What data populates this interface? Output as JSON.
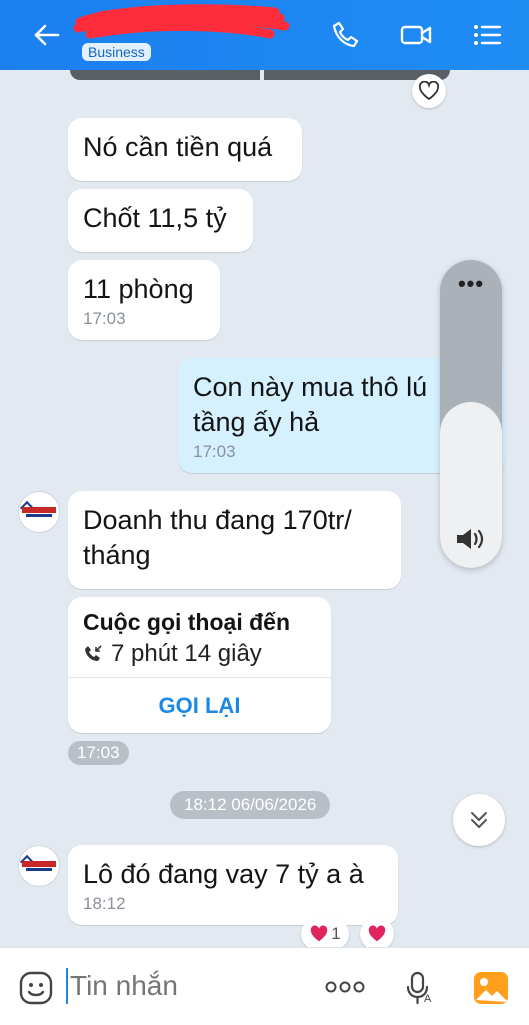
{
  "header": {
    "back_icon": "arrow-left-icon",
    "badge": "Business",
    "actions": [
      "phone-icon",
      "video-icon",
      "menu-icon"
    ],
    "color": "#1b7ff0"
  },
  "messages": [
    {
      "text": "Nó cần tiền quá"
    },
    {
      "text": "Chốt 11,5 tỷ"
    },
    {
      "text": "11 phòng",
      "time": "17:03"
    },
    {
      "text_line1": "Con này mua thô lú",
      "text_line2": "tầng ấy hả",
      "time": "17:03"
    },
    {
      "text_line1": "Doanh thu đang 170tr/",
      "text_line2": "tháng"
    },
    {
      "text": "Lô đó đang vay 7 tỷ a à",
      "time": "18:12"
    }
  ],
  "call_card": {
    "title": "Cuộc gọi thoại đến",
    "duration": "7 phút 14 giây",
    "action": "GỌI LẠI"
  },
  "call_time": "17:03",
  "date_separator": "18:12 06/06/2026",
  "reactions": {
    "heart_count": "1"
  },
  "volume": {
    "level": 0.54,
    "menu": "•••"
  },
  "composer": {
    "placeholder": "Tin nhắn",
    "icons": [
      "emoji-icon",
      "more-icon",
      "voice-icon",
      "image-icon"
    ]
  },
  "colors": {
    "accent": "#1e88e5",
    "outgoing_bubble": "#d5f1ff",
    "background": "#e2e9f1"
  }
}
